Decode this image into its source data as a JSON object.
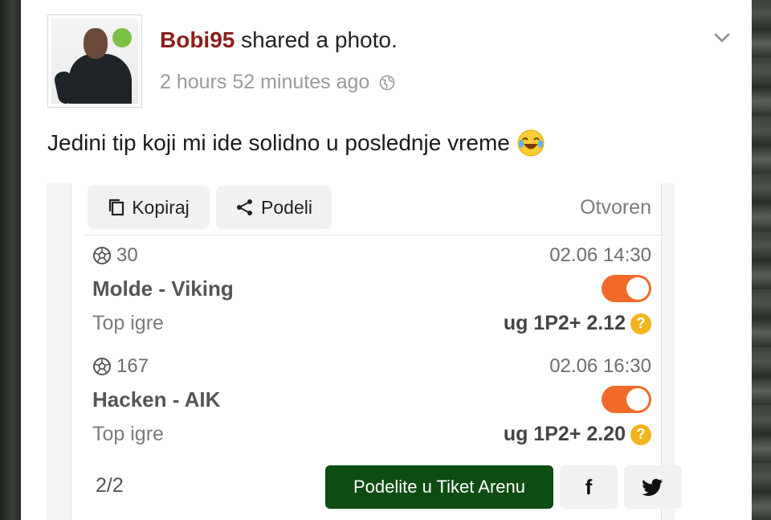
{
  "post": {
    "username": "Bobi95",
    "action": "shared a photo.",
    "time": "2 hours 52 minutes ago",
    "text": "Jedini tip koji mi ide solidno u poslednje vreme",
    "emoji": "😂"
  },
  "ticket": {
    "copy_label": "Kopiraj",
    "share_label": "Podeli",
    "status": "Otvoren",
    "events": [
      {
        "number": "30",
        "datetime": "02.06 14:30",
        "match": "Molde - Viking",
        "market": "Top igre",
        "pick": "ug 1P2+ 2.12",
        "toggle_on": true
      },
      {
        "number": "167",
        "datetime": "02.06 16:30",
        "match": "Hacken - AIK",
        "market": "Top igre",
        "pick": "ug 1P2+ 2.20",
        "toggle_on": true
      }
    ],
    "page": "2/2",
    "arena_button": "Podelite u Tiket Arenu",
    "help_glyph": "?",
    "facebook_glyph": "f"
  },
  "colors": {
    "username": "#8a1f1c",
    "toggle": "#f26a2a",
    "arena_button": "#0d4d12",
    "help_badge": "#f2b51e",
    "online_dot": "#7bc043"
  },
  "icons": {
    "avatar": "avatar-icon",
    "online": "online-status-icon",
    "privacy": "globe-icon",
    "menu": "chevron-down-icon",
    "copy": "copy-icon",
    "share": "share-icon",
    "sport": "soccer-ball-icon",
    "help": "question-icon",
    "facebook": "facebook-icon",
    "twitter": "twitter-icon"
  }
}
